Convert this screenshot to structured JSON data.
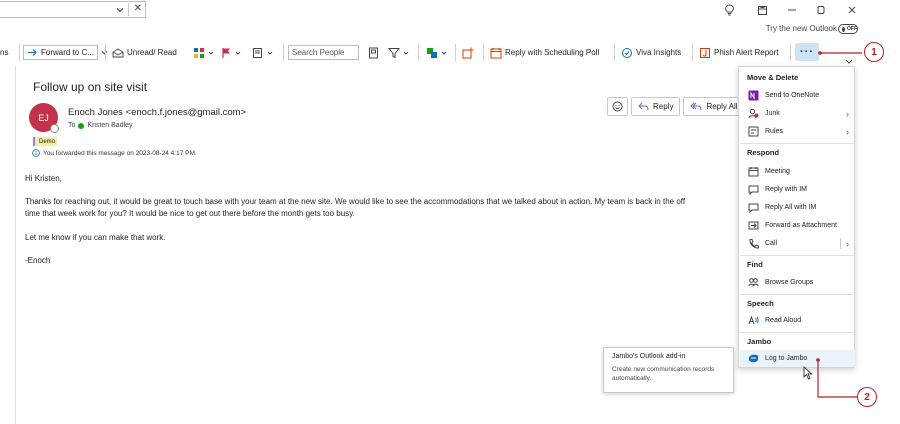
{
  "titlebar": {
    "dropdown_text": "",
    "close_glyph": "✕",
    "icons": [
      "lightbulb-icon",
      "restore-window-icon",
      "minimize-icon",
      "maximize-icon",
      "close-icon"
    ]
  },
  "try_new": {
    "label": "Try the new Outlook",
    "toggle": "OFF"
  },
  "ribbon": {
    "forward_to": "Forward to C...",
    "unread_read": "Unread/ Read",
    "search_people_placeholder": "Search People",
    "reply_poll": "Reply with Scheduling Poll",
    "viva": "Viva Insights",
    "phish": "Phish Alert Report",
    "more": "···",
    "truncated_left": "ns"
  },
  "callouts": {
    "one": "1",
    "two": "2"
  },
  "message": {
    "subject": "Follow up on site visit",
    "avatar_initials": "EJ",
    "from": "Enoch Jones <enoch.f.jones@gmail.com>",
    "to_label": "To",
    "to_name": "Kristen Badley",
    "category": "Demo",
    "forwarded_info": "You forwarded this message on 2023-08-24 4:17 PM.",
    "actions": {
      "reply": "Reply",
      "reply_all": "Reply All"
    },
    "body": {
      "greeting": "Hi Kristen,",
      "para1_line1": "Thanks for reaching out, it would be great to touch base with your team at the new site. We would like to see the accommodations that we talked about in action. My team is back in the off",
      "para1_line2": "time that week work for you? It would be nice to get out there before the month gets too busy.",
      "para2": "Let me know if you can make that work.",
      "signoff": "-Enoch"
    }
  },
  "menu": {
    "sections": {
      "move_delete": "Move & Delete",
      "respond": "Respond",
      "find": "Find",
      "speech": "Speech",
      "jambo": "Jambo"
    },
    "items": {
      "send_onenote": "Send to OneNote",
      "junk": "Junk",
      "rules": "Rules",
      "meeting": "Meeting",
      "reply_im": "Reply with IM",
      "reply_all_im": "Reply All with IM",
      "forward_attachment": "Forward as Attachment",
      "call": "Call",
      "browse_groups": "Browse Groups",
      "read_aloud": "Read Aloud",
      "log_to_jambo": "Log to Jambo"
    },
    "submenu_arrow": "›"
  },
  "tooltip": {
    "title": "Jambo's Outlook add-in",
    "description": "Create new communication records automatically."
  },
  "colors": {
    "accent": "#0f6cbd",
    "callout": "#b4231e",
    "avatar": "#c4314b",
    "more_button_bg": "#cfe3f7",
    "hover_bg": "#ebf3fc"
  }
}
